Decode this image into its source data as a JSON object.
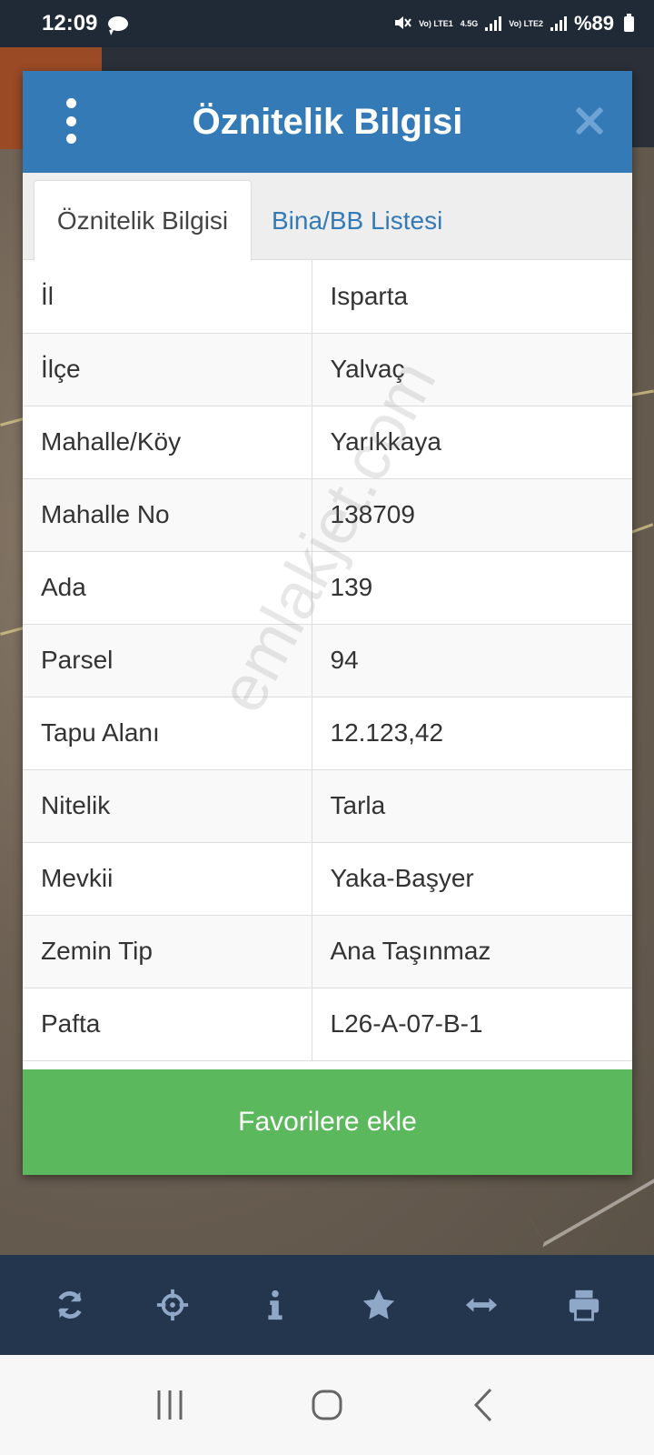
{
  "status_bar": {
    "time": "12:09",
    "network_1": "Vo) LTE1",
    "network_type": "4.5G",
    "network_2": "Vo) LTE2",
    "battery": "%89"
  },
  "dialog": {
    "title": "Öznitelik Bilgisi",
    "tabs": [
      {
        "label": "Öznitelik Bilgisi",
        "active": true
      },
      {
        "label": "Bina/BB Listesi",
        "active": false
      }
    ],
    "rows": [
      {
        "label": "İl",
        "value": "Isparta"
      },
      {
        "label": "İlçe",
        "value": "Yalvaç"
      },
      {
        "label": "Mahalle/Köy",
        "value": "Yarıkkaya"
      },
      {
        "label": "Mahalle No",
        "value": "138709"
      },
      {
        "label": "Ada",
        "value": "139"
      },
      {
        "label": "Parsel",
        "value": "94"
      },
      {
        "label": "Tapu Alanı",
        "value": "12.123,42"
      },
      {
        "label": "Nitelik",
        "value": "Tarla"
      },
      {
        "label": "Mevkii",
        "value": "Yaka-Başyer"
      },
      {
        "label": "Zemin Tip",
        "value": "Ana Taşınmaz"
      },
      {
        "label": "Pafta",
        "value": "L26-A-07-B-1"
      }
    ],
    "favorite_button": "Favorilere ekle"
  },
  "watermark": "emlakjet.com",
  "toolbar": {
    "icons": [
      "refresh-icon",
      "crosshair-icon",
      "info-icon",
      "star-icon",
      "measure-icon",
      "print-icon"
    ]
  },
  "colors": {
    "header_blue": "#337ab7",
    "button_green": "#5cb85c",
    "toolbar_bg": "#24364e",
    "toolbar_icon": "#8fa8c8"
  }
}
